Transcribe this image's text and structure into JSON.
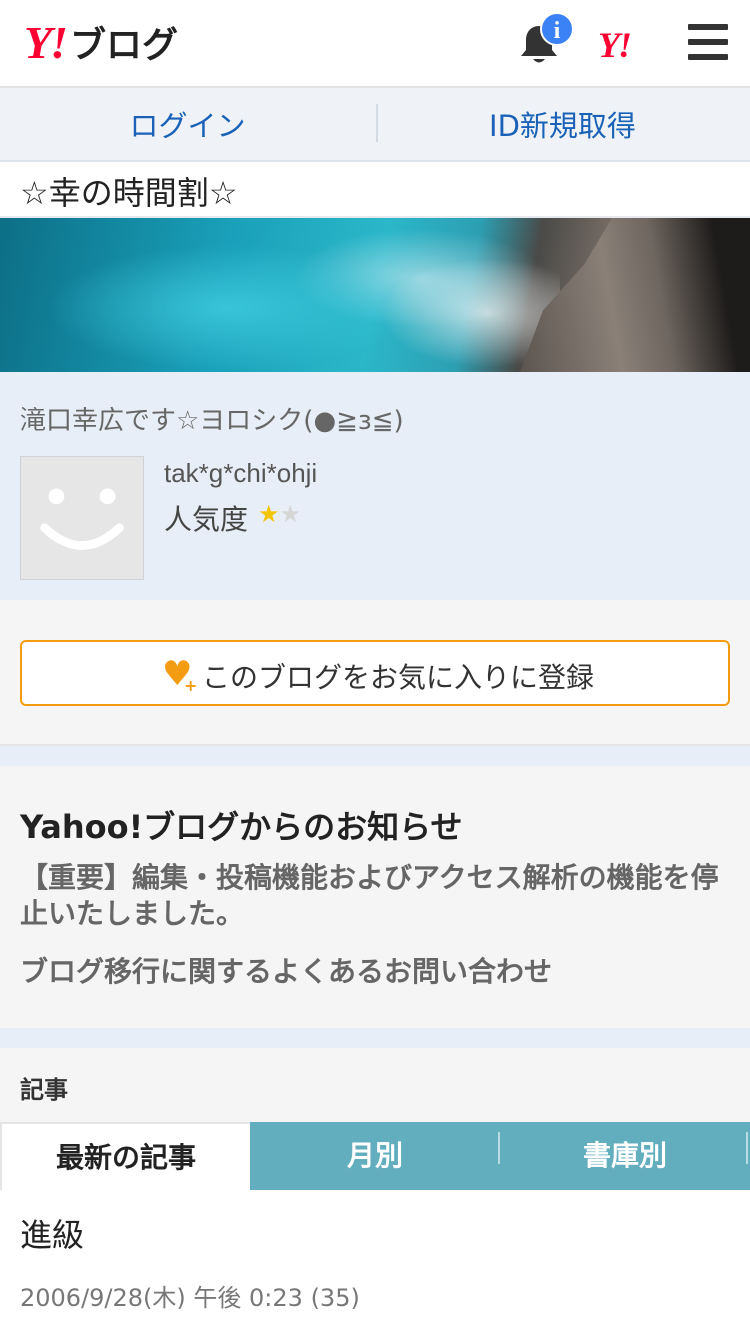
{
  "header": {
    "logo_y": "Y!",
    "logo_text": "ブログ",
    "notification_badge": "i",
    "yahoo_icon": "Y!",
    "icons": [
      "bell-icon",
      "menu-icon"
    ],
    "brand_color": "#ff0033"
  },
  "auth": {
    "login": "ログイン",
    "signup": "ID新規取得"
  },
  "blog": {
    "title": "☆幸の時間割☆",
    "description": "滝口幸広です☆ヨロシク(●≧з≦)",
    "user_id": "tak*g*chi*ohji",
    "popularity_label": "人気度",
    "popularity_stars": 1,
    "popularity_max": 2
  },
  "favorite": {
    "label": "このブログをお気に入りに登録",
    "accent": "#f39c12"
  },
  "notice": {
    "heading": "Yahoo!ブログからのお知らせ",
    "item1": "【重要】編集・投稿機能およびアクセス解析の機能を停止いたしました。",
    "item2": "ブログ移行に関するよくあるお問い合わせ"
  },
  "articles": {
    "section": "記事",
    "tabs": [
      "最新の記事",
      "月別",
      "書庫別"
    ],
    "tab_color": "#62aebe",
    "post": {
      "title": "進級",
      "meta": "2006/9/28(木) 午後 0:23 (35)"
    }
  }
}
